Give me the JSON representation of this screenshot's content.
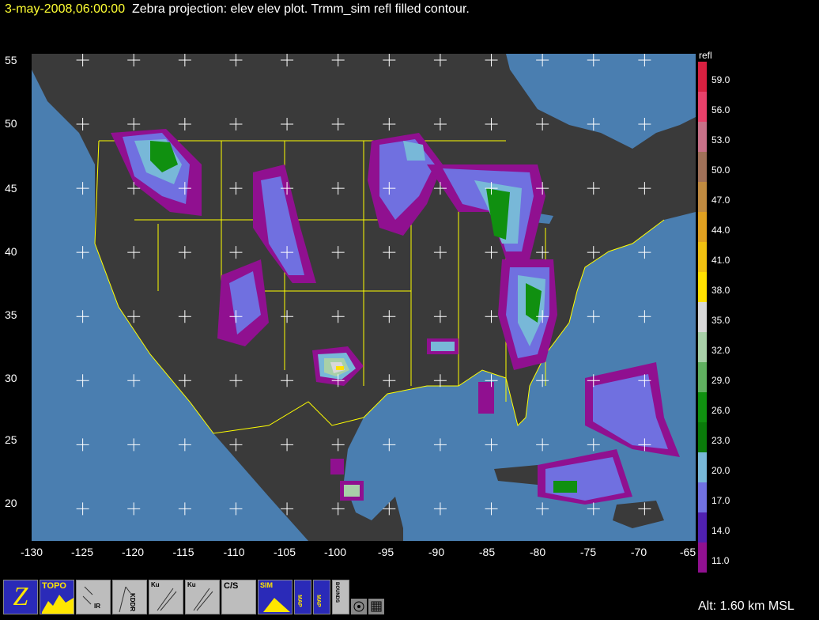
{
  "header": {
    "timestamp": "3-may-2008,06:00:00",
    "title": "Zebra projection: elev elev  plot.  Trmm_sim refl filled contour."
  },
  "map": {
    "lat_labels": [
      "55",
      "50",
      "45",
      "40",
      "35",
      "30",
      "25",
      "20"
    ],
    "lon_labels": [
      "-130",
      "-125",
      "-120",
      "-115",
      "-110",
      "-105",
      "-100",
      "-95",
      "-90",
      "-85",
      "-80",
      "-75",
      "-70",
      "-65"
    ],
    "ocean_color": "#4a7eb0",
    "land_color": "#3c3c3c",
    "border_color": "#ffff00",
    "grid_marker_color": "#ffffff"
  },
  "colorbar": {
    "title": "refl",
    "labels": [
      "59.0",
      "56.0",
      "53.0",
      "50.0",
      "47.0",
      "44.0",
      "41.0",
      "38.0",
      "35.0",
      "32.0",
      "29.0",
      "26.0",
      "23.0",
      "20.0",
      "17.0",
      "14.0",
      "11.0"
    ],
    "colors": [
      "#d82040",
      "#e8406a",
      "#c87088",
      "#a07058",
      "#c08a40",
      "#e0a020",
      "#f0c010",
      "#ffe000",
      "#d8d8d8",
      "#a8d0a8",
      "#60b060",
      "#109010",
      "#0a7a0a",
      "#78b8d8",
      "#7070e0",
      "#5020b0",
      "#901090"
    ]
  },
  "toolbar": {
    "buttons": [
      {
        "name": "zebra-button",
        "label": "Z"
      },
      {
        "name": "topo-button",
        "label": "TOPO"
      },
      {
        "name": "ir-button",
        "label": "IR"
      },
      {
        "name": "kddr-button",
        "label": "KDDR"
      },
      {
        "name": "ku-gpm-button",
        "label": "Ku"
      },
      {
        "name": "ku-gpm2-button",
        "label": "Ku"
      },
      {
        "name": "cs-gpm-button",
        "label": "C/S"
      },
      {
        "name": "sim-pr-button",
        "label": "SIM"
      },
      {
        "name": "map-button",
        "label": "MAP"
      },
      {
        "name": "map2-button",
        "label": "MAP"
      },
      {
        "name": "bounds-button",
        "label": "BOUNDS"
      }
    ]
  },
  "status": {
    "altitude": "Alt: 1.60 km MSL"
  }
}
